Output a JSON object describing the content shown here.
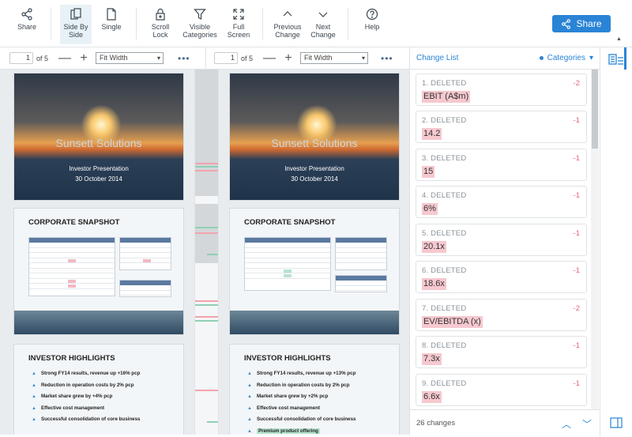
{
  "toolbar": {
    "share_label": "Share",
    "side_by_side_label_1": "Side By",
    "side_by_side_label_2": "Side",
    "single_label": "Single",
    "scroll_lock_label_1": "Scroll",
    "scroll_lock_label_2": "Lock",
    "visible_categories_label_1": "Visible",
    "visible_categories_label_2": "Categories",
    "full_screen_label_1": "Full",
    "full_screen_label_2": "Screen",
    "previous_change_label_1": "Previous",
    "previous_change_label_2": "Change",
    "next_change_label_1": "Next",
    "next_change_label_2": "Change",
    "help_label": "Help",
    "share_main_label": "Share"
  },
  "left_pane": {
    "page_value": "1",
    "page_total": "of 5",
    "zoom_out": "—",
    "zoom_in": "+",
    "fit": "Fit Width",
    "more": "•••"
  },
  "right_pane": {
    "page_value": "1",
    "page_total": "of 5",
    "zoom_out": "—",
    "zoom_in": "+",
    "fit": "Fit Width",
    "more": "•••"
  },
  "slides": {
    "company": "Sunsett Solutions",
    "subtitle1": "Investor Presentation",
    "subtitle2": "30 October 2014",
    "snapshot_title": "CORPORATE SNAPSHOT",
    "highlights_title": "INVESTOR HIGHLIGHTS",
    "left_highlights": [
      "Strong FY14 results, revenue up +16% pcp",
      "Reduction in operation costs by 2% pcp",
      "Market share grew by +4% pcp",
      "Effective cost management",
      "Successful consolidation of core business"
    ],
    "right_highlights": [
      "Strong FY14 results, revenue up +13% pcp",
      "Reduction in operation costs by 2% pcp",
      "Market share grew by +2% pcp",
      "Effective cost management",
      "Successful consolidation of core business",
      "Premium product offering"
    ]
  },
  "change_list": {
    "title": "Change List",
    "categories_label": "Categories",
    "categories_caret": "▾",
    "items": [
      {
        "label": "1. DELETED",
        "count": "-2",
        "value": "EBIT (A$m)"
      },
      {
        "label": "2. DELETED",
        "count": "-1",
        "value": "14.2"
      },
      {
        "label": "3. DELETED",
        "count": "-1",
        "value": "15"
      },
      {
        "label": "4. DELETED",
        "count": "-1",
        "value": "6%"
      },
      {
        "label": "5. DELETED",
        "count": "-1",
        "value": "20.1x"
      },
      {
        "label": "6. DELETED",
        "count": "-1",
        "value": "18.6x"
      },
      {
        "label": "7. DELETED",
        "count": "-2",
        "value": "EV/EBITDA (x)"
      },
      {
        "label": "8. DELETED",
        "count": "-1",
        "value": "7.3x"
      },
      {
        "label": "9. DELETED",
        "count": "-1",
        "value": "6.6x"
      }
    ],
    "footer": "26 changes",
    "prev_glyph": "︿",
    "next_glyph": "﹀"
  },
  "colors": {
    "accent": "#2a84d6",
    "deleted_highlight": "#f6c8cf",
    "deleted_count": "#e56878",
    "added_highlight": "#b7e3cf"
  }
}
